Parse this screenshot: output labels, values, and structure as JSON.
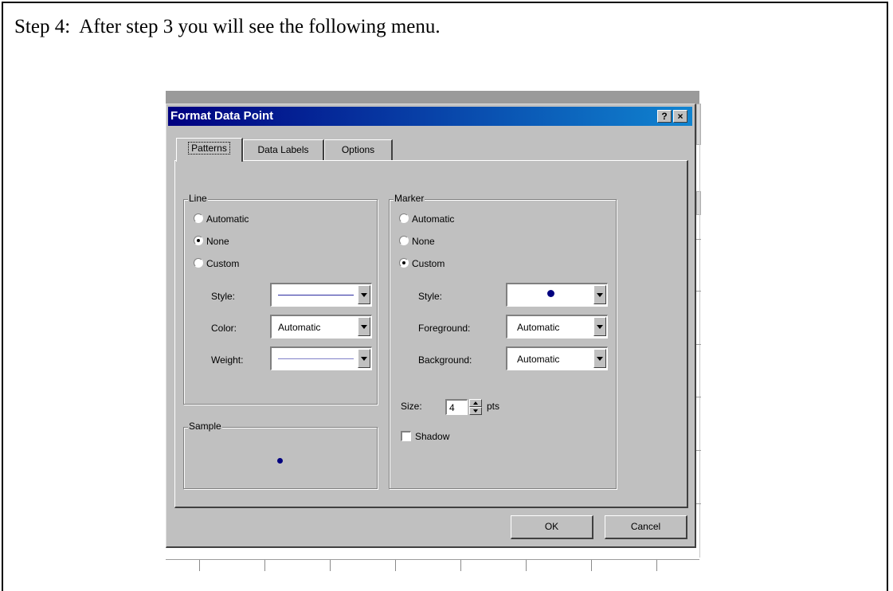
{
  "caption": "Step 4:  After step 3 you will see the following menu.",
  "dialog": {
    "title": "Format Data Point",
    "help_glyph": "?",
    "close_glyph": "×",
    "tabs": [
      "Patterns",
      "Data Labels",
      "Options"
    ],
    "active_tab": "Patterns",
    "line_group": {
      "label": "Line",
      "options": [
        "Automatic",
        "None",
        "Custom"
      ],
      "selected": "None",
      "style_label": "Style:",
      "color_label": "Color:",
      "color_value": "Automatic",
      "weight_label": "Weight:"
    },
    "sample_group": {
      "label": "Sample"
    },
    "marker_group": {
      "label": "Marker",
      "options": [
        "Automatic",
        "None",
        "Custom"
      ],
      "selected": "Custom",
      "style_label": "Style:",
      "foreground_label": "Foreground:",
      "foreground_value": "Automatic",
      "background_label": "Background:",
      "background_value": "Automatic",
      "size_label": "Size:",
      "size_value": "4",
      "size_unit": "pts",
      "shadow_label": "Shadow",
      "shadow_checked": false
    },
    "ok_label": "OK",
    "cancel_label": "Cancel"
  },
  "colors": {
    "titlebar_start": "#000080",
    "titlebar_end": "#1084d0",
    "dialog_face": "#c0c0c0",
    "marker": "#00007f"
  },
  "icons": {
    "help": "question-mark",
    "close": "x-close",
    "dropdown": "triangle-down",
    "marker_style": "filled-circle"
  }
}
